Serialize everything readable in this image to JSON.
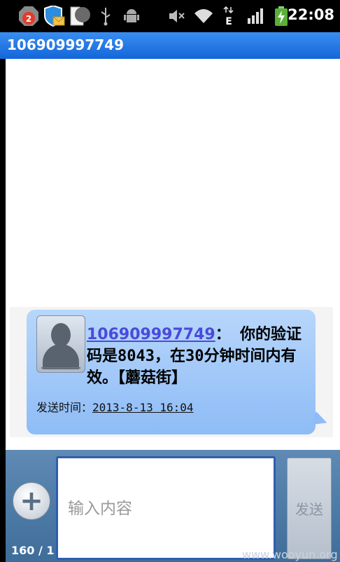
{
  "status_bar": {
    "notification_count": "2",
    "time": "22:08",
    "network_type": "E",
    "icons": [
      "messaging-badge-icon",
      "security-mail-icon",
      "document-icon",
      "usb-icon",
      "android-debug-icon",
      "mute-icon",
      "wifi-icon",
      "data-transfer-icon",
      "signal-icon",
      "battery-charging-icon"
    ]
  },
  "title_bar": {
    "title": "106909997749"
  },
  "message": {
    "sender": "106909997749",
    "separator": "：",
    "body": "你的验证码是8043，在30分钟时间内有效。【蘑菇街】",
    "sent_label": "发送时间：",
    "sent_time": "2013-8-13 16:04"
  },
  "compose": {
    "counter": "160 / 1",
    "placeholder": "输入内容",
    "send_label": "发送"
  },
  "watermark": "www.wooyun.org",
  "colors": {
    "title_bar": "#1f74e0",
    "bubble": "#a7cbf9",
    "link": "#4a4adb",
    "compose_border": "#2f5db0"
  }
}
